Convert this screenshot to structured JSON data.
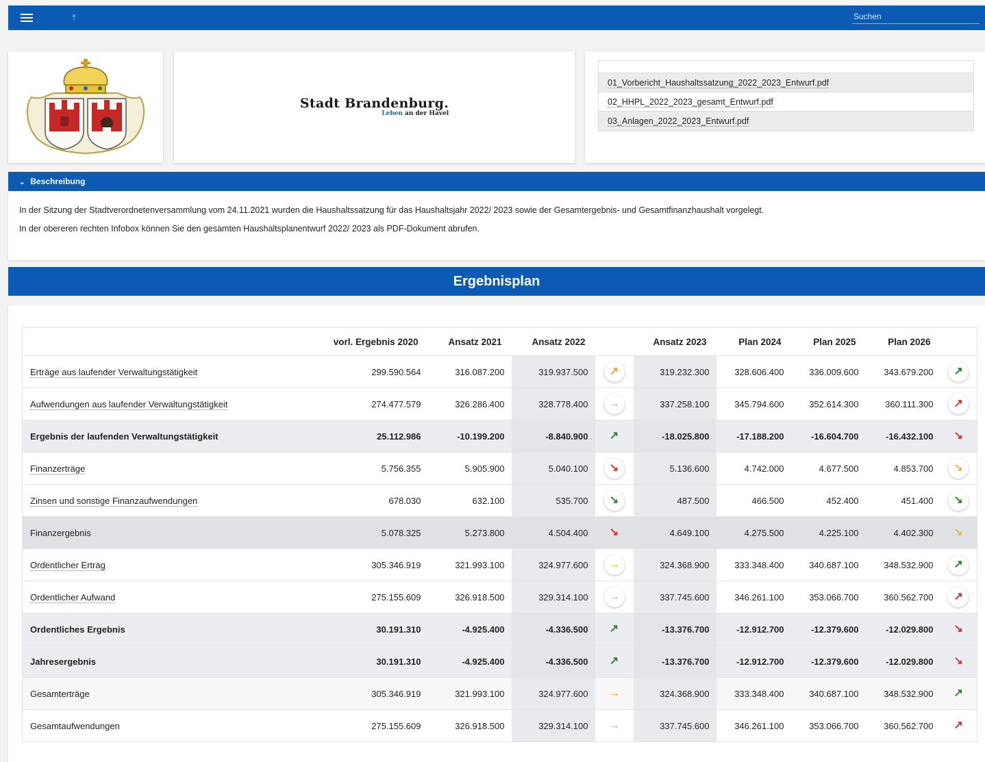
{
  "topbar": {
    "search_placeholder": "Suchen"
  },
  "brand": {
    "name": "Stadt Brandenburg.",
    "sub_blue": "Leben",
    "sub_rest": " an der Havel"
  },
  "files": [
    "01_Vorbericht_Haushaltssatzung_2022_2023_Entwurf.pdf",
    "02_HHPL_2022_2023_gesamt_Entwurf.pdf",
    "03_Anlagen_2022_2023_Entwurf.pdf"
  ],
  "description": {
    "header": "Beschreibung",
    "paragraphs": [
      "In der Sitzung der Stadtverordnetenversammlung vom 24.11.2021 wurden die Haushaltssatzung für das Haushaltsjahr 2022/ 2023 sowie der Gesamtergebnis- und Gesamtfinanzhaushalt vorgelegt.",
      "In der obereren rechten Infobox können Sie den gesamten Haushaltsplanentwurf 2022/ 2023 als PDF-Dokument abrufen."
    ]
  },
  "plan": {
    "title": "Ergebnisplan",
    "columns": [
      "vorl. Ergebnis 2020",
      "Ansatz 2021",
      "Ansatz 2022",
      "Ansatz 2023",
      "Plan 2024",
      "Plan 2025",
      "Plan 2026"
    ],
    "rows": [
      {
        "label": "Erträge aus laufender Verwaltungstätigkeit",
        "type": "link",
        "v": [
          "299.590.564",
          "316.087.200",
          "319.937.500",
          "319.232.300",
          "328.606.400",
          "336.009.600",
          "343.679.200"
        ],
        "a1": {
          "icon": "↗",
          "color": "orange",
          "button": true,
          "name": "trend-up-right-icon"
        },
        "a2": {
          "icon": "↗",
          "color": "green",
          "button": true,
          "name": "trend-up-right-icon"
        }
      },
      {
        "label": "Aufwendungen aus laufender Verwaltungstätigkeit",
        "type": "link",
        "v": [
          "274.477.579",
          "326.286.400",
          "328.778.400",
          "337.258.100",
          "345.794.600",
          "352.614.300",
          "360.111.300"
        ],
        "a1": {
          "icon": "→",
          "color": "orange",
          "button": true,
          "name": "trend-right-icon"
        },
        "a2": {
          "icon": "↗",
          "color": "red",
          "button": true,
          "name": "trend-up-right-icon"
        }
      },
      {
        "label": "Ergebnis der laufenden Verwaltungstätigkeit",
        "type": "bold",
        "v": [
          "25.112.986",
          "-10.199.200",
          "-8.840.900",
          "-18.025.800",
          "-17.188.200",
          "-16.604.700",
          "-16.432.100"
        ],
        "a1": {
          "icon": "↗",
          "color": "green",
          "button": false,
          "name": "trend-up-right-icon"
        },
        "a2": {
          "icon": "↘",
          "color": "red",
          "button": false,
          "name": "trend-down-right-icon"
        }
      },
      {
        "label": "Finanzerträge",
        "type": "link",
        "v": [
          "5.756.355",
          "5.905.900",
          "5.040.100",
          "5.136.600",
          "4.742.000",
          "4.677.500",
          "4.853.700"
        ],
        "a1": {
          "icon": "↘",
          "color": "red",
          "button": true,
          "name": "trend-down-right-icon"
        },
        "a2": {
          "icon": "↘",
          "color": "yellow",
          "button": true,
          "name": "trend-down-right-icon"
        }
      },
      {
        "label": "Zinsen und sonstige Finanzaufwendungen",
        "type": "link",
        "v": [
          "678.030",
          "632.100",
          "535.700",
          "487.500",
          "466.500",
          "452.400",
          "451.400"
        ],
        "a1": {
          "icon": "↘",
          "color": "green",
          "button": true,
          "name": "trend-down-right-icon"
        },
        "a2": {
          "icon": "↘",
          "color": "green",
          "button": true,
          "name": "trend-down-right-icon"
        }
      },
      {
        "label": "Finanzergebnis",
        "type": "finanz",
        "v": [
          "5.078.325",
          "5.273.800",
          "4.504.400",
          "4.649.100",
          "4.275.500",
          "4.225.100",
          "4.402.300"
        ],
        "a1": {
          "icon": "↘",
          "color": "red",
          "button": false,
          "name": "trend-down-right-icon"
        },
        "a2": {
          "icon": "↘",
          "color": "yellow",
          "button": false,
          "name": "trend-down-right-icon"
        }
      },
      {
        "label": "Ordentlicher Ertrag",
        "type": "link",
        "v": [
          "305.346.919",
          "321.993.100",
          "324.977.600",
          "324.368.900",
          "333.348.400",
          "340.687.100",
          "348.532.900"
        ],
        "a1": {
          "icon": "→",
          "color": "orange",
          "button": true,
          "name": "trend-right-icon"
        },
        "a2": {
          "icon": "↗",
          "color": "green",
          "button": true,
          "name": "trend-up-right-icon"
        }
      },
      {
        "label": "Ordentlicher Aufwand",
        "type": "link",
        "v": [
          "275.155.609",
          "326.918.500",
          "329.314.100",
          "337.745.600",
          "346.261.100",
          "353.066.700",
          "360.562.700"
        ],
        "a1": {
          "icon": "→",
          "color": "orange",
          "button": true,
          "name": "trend-right-icon"
        },
        "a2": {
          "icon": "↗",
          "color": "red",
          "button": true,
          "name": "trend-up-right-icon"
        }
      },
      {
        "label": "Ordentliches Ergebnis",
        "type": "bold",
        "v": [
          "30.191.310",
          "-4.925.400",
          "-4.336.500",
          "-13.376.700",
          "-12.912.700",
          "-12.379.600",
          "-12.029.800"
        ],
        "a1": {
          "icon": "↗",
          "color": "green",
          "button": false,
          "name": "trend-up-right-icon"
        },
        "a2": {
          "icon": "↘",
          "color": "red",
          "button": false,
          "name": "trend-down-right-icon"
        }
      },
      {
        "label": "Jahresergebnis",
        "type": "bold",
        "v": [
          "30.191.310",
          "-4.925.400",
          "-4.336.500",
          "-13.376.700",
          "-12.912.700",
          "-12.379.600",
          "-12.029.800"
        ],
        "a1": {
          "icon": "↗",
          "color": "green",
          "button": false,
          "name": "trend-up-right-icon"
        },
        "a2": {
          "icon": "↘",
          "color": "red",
          "button": false,
          "name": "trend-down-right-icon"
        }
      },
      {
        "label": "Gesamterträge",
        "type": "normal",
        "v": [
          "305.346.919",
          "321.993.100",
          "324.977.600",
          "324.368.900",
          "333.348.400",
          "340.687.100",
          "348.532.900"
        ],
        "a1": {
          "icon": "→",
          "color": "orange",
          "button": false,
          "name": "trend-right-icon"
        },
        "a2": {
          "icon": "↗",
          "color": "green",
          "button": false,
          "name": "trend-up-right-icon"
        }
      },
      {
        "label": "Gesamtaufwendungen",
        "type": "normal",
        "v": [
          "275.155.609",
          "326.918.500",
          "329.314.100",
          "337.745.600",
          "346.261.100",
          "353.066.700",
          "360.562.700"
        ],
        "a1": {
          "icon": "→",
          "color": "orange",
          "button": false,
          "name": "trend-right-icon"
        },
        "a2": {
          "icon": "↗",
          "color": "red",
          "button": false,
          "name": "trend-up-right-icon"
        }
      }
    ]
  }
}
